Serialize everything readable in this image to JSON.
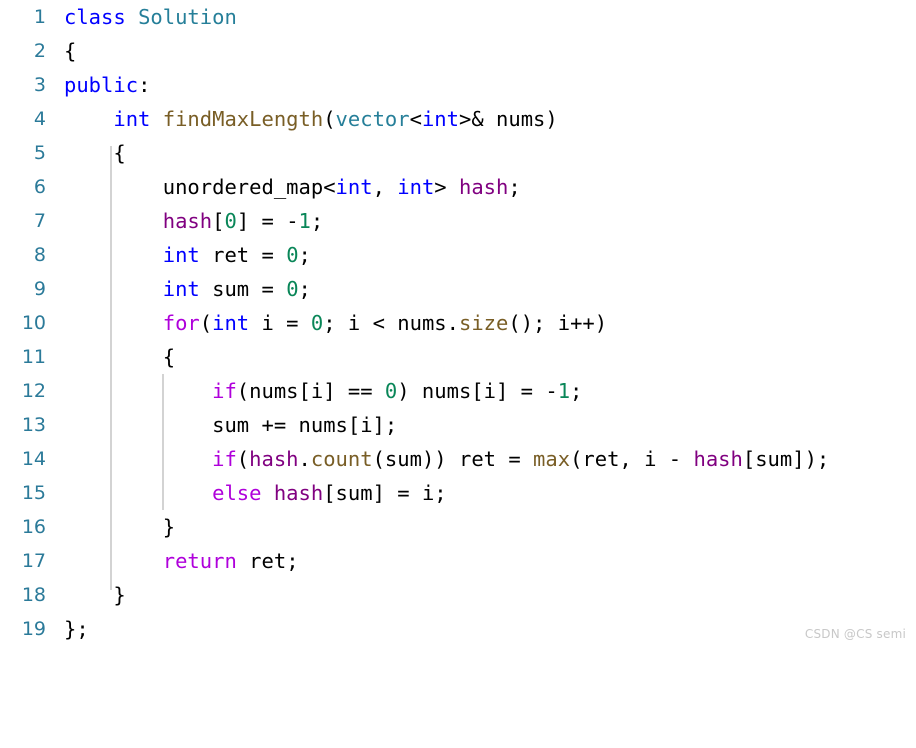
{
  "editor": {
    "language": "cpp",
    "background_color": "#ffffff",
    "line_number_color": "#2b7a99",
    "indent_guide_color": "#d3d3d3",
    "first_line": 1,
    "last_line": 19,
    "total_lines": 19
  },
  "theme_colors": {
    "keyword": "#0000ff",
    "control_keyword": "#af00db",
    "type": "#267f99",
    "function": "#795e26",
    "member_variable": "#800080",
    "number": "#098658",
    "plain_text": "#000000",
    "watermark": "#c8c8c8"
  },
  "line_numbers": [
    "1",
    "2",
    "3",
    "4",
    "5",
    "6",
    "7",
    "8",
    "9",
    "10",
    "11",
    "12",
    "13",
    "14",
    "15",
    "16",
    "17",
    "18",
    "19"
  ],
  "code_lines": [
    {
      "number": "1",
      "text": "class Solution"
    },
    {
      "number": "2",
      "text": "{"
    },
    {
      "number": "3",
      "text": "public:"
    },
    {
      "number": "4",
      "text": "    int findMaxLength(vector<int>& nums)"
    },
    {
      "number": "5",
      "text": "    {"
    },
    {
      "number": "6",
      "text": "        unordered_map<int, int> hash;"
    },
    {
      "number": "7",
      "text": "        hash[0] = -1;"
    },
    {
      "number": "8",
      "text": "        int ret = 0;"
    },
    {
      "number": "9",
      "text": "        int sum = 0;"
    },
    {
      "number": "10",
      "text": "        for(int i = 0; i < nums.size(); i++)"
    },
    {
      "number": "11",
      "text": "        {"
    },
    {
      "number": "12",
      "text": "            if(nums[i] == 0) nums[i] = -1;"
    },
    {
      "number": "13",
      "text": "            sum += nums[i];"
    },
    {
      "number": "14",
      "text": "            if(hash.count(sum)) ret = max(ret, i - hash[sum]);"
    },
    {
      "number": "15",
      "text": "            else hash[sum] = i;"
    },
    {
      "number": "16",
      "text": "        }"
    },
    {
      "number": "17",
      "text": "        return ret;"
    },
    {
      "number": "18",
      "text": "    }"
    },
    {
      "number": "19",
      "text": "};"
    }
  ],
  "tokens": {
    "l1": {
      "kw_class": "class",
      "sp1": " ",
      "type_solution": "Solution"
    },
    "l2": {
      "brace": "{"
    },
    "l3": {
      "kw_public": "public",
      "colon": ":"
    },
    "l4": {
      "indent": "    ",
      "kw_int": "int",
      "sp1": " ",
      "fn_name": "findMaxLength",
      "paren_open": "(",
      "type_vector": "vector",
      "lt": "<",
      "kw_int2": "int",
      "gt_amp": ">& ",
      "var_nums": "nums",
      "paren_close": ")"
    },
    "l5": {
      "indent": "    ",
      "brace": "{"
    },
    "l6": {
      "indent": "        ",
      "type_umap": "unordered_map",
      "lt": "<",
      "kw_int": "int",
      "comma": ", ",
      "kw_int2": "int",
      "gt": "> ",
      "var_hash": "hash",
      "semi": ";"
    },
    "l7": {
      "indent": "        ",
      "var_hash": "hash",
      "bracket_open": "[",
      "num_zero": "0",
      "bracket_close": "] ",
      "eq": "= ",
      "minus": "-",
      "num_one": "1",
      "semi": ";"
    },
    "l8": {
      "indent": "        ",
      "kw_int": "int",
      "var_ret": " ret = ",
      "num_zero": "0",
      "semi": ";"
    },
    "l9": {
      "indent": "        ",
      "kw_int": "int",
      "var_sum": " sum = ",
      "num_zero": "0",
      "semi": ";"
    },
    "l10": {
      "indent": "        ",
      "kw_for": "for",
      "paren_open": "(",
      "kw_int": "int",
      "mid1": " i = ",
      "num_zero": "0",
      "mid2": "; i < ",
      "var_nums": "nums",
      "dot": ".",
      "fn_size": "size",
      "tail": "(); i++)"
    },
    "l11": {
      "indent": "        ",
      "brace": "{"
    },
    "l12": {
      "indent": "            ",
      "kw_if": "if",
      "mid1": "(nums[i] == ",
      "num_zero": "0",
      "mid2": ") nums[i] = -",
      "num_one": "1",
      "semi": ";"
    },
    "l13": {
      "indent": "            ",
      "body": "sum += nums[i];"
    },
    "l14": {
      "indent": "            ",
      "kw_if": "if",
      "paren_open": "(",
      "var_hash": "hash",
      "dot": ".",
      "fn_count": "count",
      "mid1": "(sum)) ret = ",
      "fn_max": "max",
      "mid2": "(ret, i - ",
      "var_hash2": "hash",
      "tail": "[sum]);"
    },
    "l15": {
      "indent": "            ",
      "kw_else": "else",
      "sp": " ",
      "var_hash": "hash",
      "tail": "[sum] = i;"
    },
    "l16": {
      "indent": "        ",
      "brace": "}"
    },
    "l17": {
      "indent": "        ",
      "kw_return": "return",
      "var_ret": " ret",
      "semi": ";"
    },
    "l18": {
      "indent": "    ",
      "brace": "}"
    },
    "l19": {
      "brace": "}",
      "semi": ";"
    }
  },
  "watermark": {
    "text": "CSDN @CS semi"
  }
}
